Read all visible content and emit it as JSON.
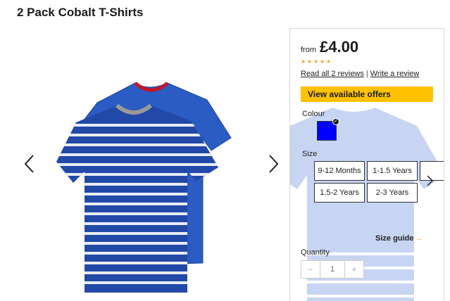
{
  "product": {
    "title": "2 Pack Cobalt T-Shirts"
  },
  "gallery": {
    "prev_icon": "chevron-left-icon",
    "next_icon": "chevron-right-icon"
  },
  "pricing": {
    "from_label": "from",
    "price": "£4.00"
  },
  "rating": {
    "stars": 5,
    "star_color": "#f5a623"
  },
  "reviews": {
    "read_all": "Read all 2 reviews",
    "separator": "|",
    "write": "Write a review"
  },
  "offers": {
    "label": "View available offers",
    "color": "#ffc100"
  },
  "colour": {
    "label": "Colour",
    "selected_swatch": "#0000ff"
  },
  "size": {
    "label": "Size",
    "options": [
      "9-12 Months",
      "1-1.5 Years",
      "",
      "1.5-2 Years",
      "2-3 Years"
    ],
    "next_icon": "chevron-right-icon"
  },
  "size_guide": {
    "label": "Size guide",
    "arrow": "→"
  },
  "quantity": {
    "label": "Quantity",
    "minus": "−",
    "value": "1",
    "plus": "+"
  }
}
